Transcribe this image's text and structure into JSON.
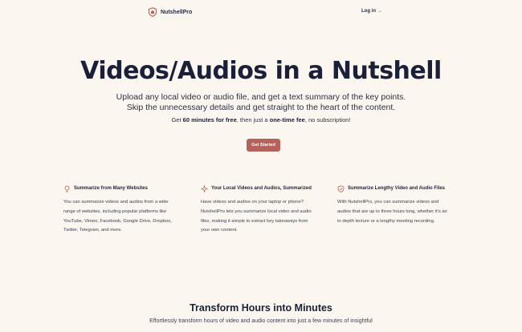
{
  "nav": {
    "brand": "NutshellPro",
    "login": "Log in",
    "login_arrow": "→"
  },
  "hero": {
    "title": "Videos/Audios in a Nutshell",
    "subtitle_line1": "Upload any local video or audio file, and get a text summary of the key points.",
    "subtitle_line2": "Skip the unnecessary details and get straight to the heart of the content.",
    "price_pre": "Get ",
    "price_bold1": "60 minutes for free",
    "price_mid": ", then just a ",
    "price_bold2": "one-time fee",
    "price_post": ", no subscription!",
    "cta_label": "Get Started"
  },
  "features": [
    {
      "icon": "bulb-icon",
      "title": "Summarize from Many Websites",
      "lines": [
        "You can summarize videos and audios from a wide",
        "range of websites, including popular platforms like",
        "YouTube, Vimeo, Facebook, Google Drive, Dropbox,",
        "Twitter, Telegram, and more."
      ]
    },
    {
      "icon": "spark-icon",
      "title": "Your Local Videos and Audios, Summarized",
      "lines": [
        "Have videos and audios on your laptop or phone?",
        "NutshellPro lets you summarize local video and audio",
        "files, making it simple to extract key takeaways from",
        "your own content."
      ]
    },
    {
      "icon": "shield-icon",
      "title": "Summarize Lengthy Video and Audio Files",
      "lines": [
        "With NutshellPro, you can summarize videos and",
        "audios that are up to three hours long, whether it's an",
        "in-depth lecture or a lengthy meeting recording."
      ]
    }
  ],
  "section": {
    "title": "Transform Hours into Minutes",
    "text": "Effortlessly transform hours of video and audio content into just a few minutes of insightful"
  },
  "colors": {
    "background": "#fcf6f1",
    "accent": "#b5625a",
    "text": "#1a2038"
  }
}
